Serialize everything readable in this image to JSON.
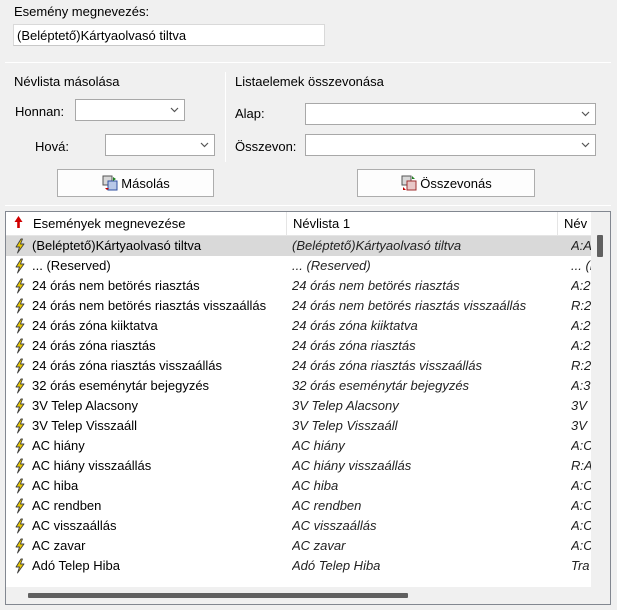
{
  "event_name": {
    "label": "Esemény megnevezés:",
    "value": "(Beléptető)Kártyaolvasó  tiltva"
  },
  "copy_group": {
    "title": "Névlista másolása",
    "from_label": "Honnan:",
    "to_label": "Hová:",
    "button_label": "Másolás"
  },
  "merge_group": {
    "title": "Listaelemek összevonása",
    "base_label": "Alap:",
    "merge_label": "Összevon:",
    "button_label": "Összevonás"
  },
  "table": {
    "columns": [
      "Események megnevezése",
      "Névlista 1",
      "Név"
    ],
    "rows": [
      {
        "name": "(Beléptető)Kártyaolvasó  tiltva",
        "list1": "(Beléptető)Kártyaolvasó  tiltva",
        "list2": "A:A",
        "selected": true
      },
      {
        "name": "... (Reserved)",
        "list1": "... (Reserved)",
        "list2": "... (R"
      },
      {
        "name": "24 órás nem betörés riasztás",
        "list1": "24 órás nem betörés riasztás",
        "list2": "A:2"
      },
      {
        "name": "24 órás nem betörés riasztás visszaállás",
        "list1": "24 órás nem betörés riasztás visszaállás",
        "list2": "R:2"
      },
      {
        "name": "24 órás zóna kiiktatva",
        "list1": "24 órás zóna kiiktatva",
        "list2": "A:2"
      },
      {
        "name": "24 órás zóna riasztás",
        "list1": "24 órás zóna riasztás",
        "list2": "A:2"
      },
      {
        "name": "24 órás zóna riasztás visszaállás",
        "list1": "24 órás zóna riasztás visszaállás",
        "list2": "R:2"
      },
      {
        "name": "32 órás eseménytár bejegyzés",
        "list1": "32 órás eseménytár bejegyzés",
        "list2": "A:3"
      },
      {
        "name": "3V Telep Alacsony",
        "list1": "3V Telep Alacsony",
        "list2": "3V"
      },
      {
        "name": "3V Telep Visszaáll",
        "list1": "3V Telep Visszaáll",
        "list2": "3V"
      },
      {
        "name": "AC hiány",
        "list1": "AC hiány",
        "list2": "A:C"
      },
      {
        "name": "AC hiány visszaállás",
        "list1": "AC hiány visszaállás",
        "list2": "R:A"
      },
      {
        "name": "AC hiba",
        "list1": "AC hiba",
        "list2": "A:C"
      },
      {
        "name": "AC rendben",
        "list1": "AC rendben",
        "list2": "A:C"
      },
      {
        "name": "AC visszaállás",
        "list1": "AC visszaállás",
        "list2": "A:C"
      },
      {
        "name": "AC zavar",
        "list1": "AC zavar",
        "list2": "A:C"
      },
      {
        "name": "Adó Telep Hiba",
        "list1": "Adó Telep Hiba",
        "list2": "Tra"
      }
    ]
  },
  "colors": {
    "selected_row": "#d9d9d9",
    "bolt": "#e8c800",
    "sort_arrow": "#d00000"
  }
}
